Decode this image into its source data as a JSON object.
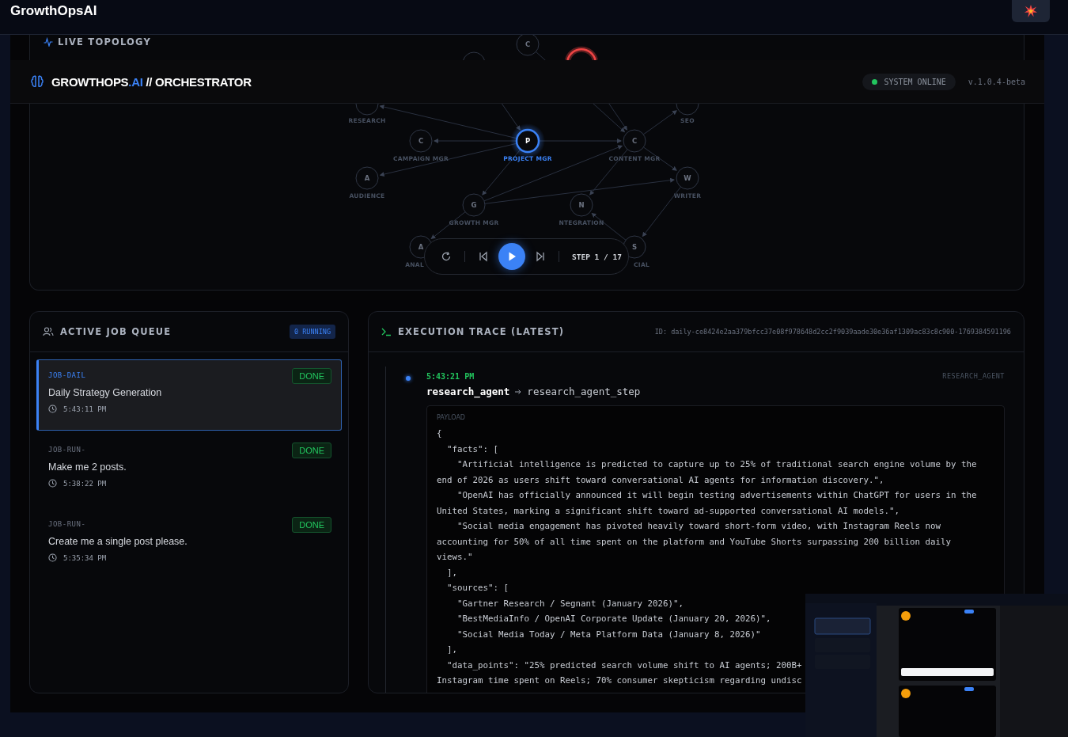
{
  "top_bar": {
    "app_title": "GrowthOpsAI"
  },
  "header": {
    "brand": "GROWTHOPS",
    "brand_suffix": ".AI",
    "brand_tail": "// ORCHESTRATOR",
    "status": "SYSTEM ONLINE",
    "online": true,
    "version": "v.1.0.4-beta"
  },
  "topology": {
    "title": "LIVE TOPOLOGY",
    "nodes": [
      {
        "letter": "C",
        "selected": false,
        "alert": false
      },
      {
        "selected": false,
        "alert": false
      },
      {
        "selected": false,
        "alert": true
      },
      {
        "label": "RESEARCH",
        "selected": false,
        "alert": false
      },
      {
        "label": "SEO",
        "selected": false,
        "alert": false
      },
      {
        "letter": "C",
        "label": "CAMPAIGN MGR",
        "selected": false,
        "alert": false
      },
      {
        "letter": "P",
        "label": "PROJECT MGR",
        "selected": true,
        "alert": false
      },
      {
        "letter": "C",
        "label": "CONTENT MGR",
        "selected": false,
        "alert": false
      },
      {
        "letter": "A",
        "label": "AUDIENCE",
        "selected": false,
        "alert": false
      },
      {
        "letter": "W",
        "label": "WRITER",
        "selected": false,
        "alert": false
      },
      {
        "letter": "G",
        "label": "GROWTH MGR",
        "selected": false,
        "alert": false
      },
      {
        "letter": "N",
        "label": "NTEGRATION",
        "selected": false,
        "alert": false
      },
      {
        "letter": "A",
        "label": "ANAL",
        "selected": false,
        "alert": false
      },
      {
        "letter": "S",
        "label": "CIAL",
        "selected": false,
        "alert": false
      }
    ],
    "controls": {
      "step": "STEP 1 / 17",
      "playing": false
    }
  },
  "job_queue": {
    "title": "ACTIVE JOB QUEUE",
    "running": "0 RUNNING",
    "jobs": [
      {
        "id": "JOB-DAIL",
        "title": "Daily Strategy Generation",
        "time": "5:43:11 PM",
        "status": "DONE",
        "selected": true
      },
      {
        "id": "JOB-RUN-",
        "title": "Make me 2 posts.",
        "time": "5:38:22 PM",
        "status": "DONE",
        "selected": false
      },
      {
        "id": "JOB-RUN-",
        "title": "Create me a single post please.",
        "time": "5:35:34 PM",
        "status": "DONE",
        "selected": false
      }
    ]
  },
  "trace": {
    "title": "EXECUTION TRACE (LATEST)",
    "trace_id": "ID: daily-ce8424e2aa379bfcc37e08f978648d2cc2f9039aade30e36af1309ac83c8c900-1769384591196",
    "steps": [
      {
        "time": "5:43:21 PM",
        "agent_tag": "RESEARCH_AGENT",
        "agent": "research_agent",
        "action": "research_agent_step",
        "payload_label": "PAYLOAD",
        "payload_lines": [
          "{",
          "  \"facts\": [",
          "    \"Artificial intelligence is predicted to capture up to 25% of traditional search engine volume by the",
          "end of 2026 as users shift toward conversational AI agents for information discovery.\",",
          "    \"OpenAI has officially announced it will begin testing advertisements within ChatGPT for users in the",
          "United States, marking a significant shift toward ad-supported conversational AI models.\",",
          "    \"Social media engagement has pivoted heavily toward short-form video, with Instagram Reels now",
          "accounting for 50% of all time spent on the platform and YouTube Shorts surpassing 200 billion daily",
          "views.\"",
          "  ],",
          "  \"sources\": [",
          "    \"Gartner Research / Segnant (January 2026)\",",
          "    \"BestMediaInfo / OpenAI Corporate Update (January 20, 2026)\",",
          "    \"Social Media Today / Meta Platform Data (January 8, 2026)\"",
          "  ],",
          "  \"data_points\": \"25% predicted search volume shift to AI agents; 200B+",
          "Instagram time spent on Reels; 70% consumer skepticism regarding undisc"
        ]
      }
    ]
  }
}
